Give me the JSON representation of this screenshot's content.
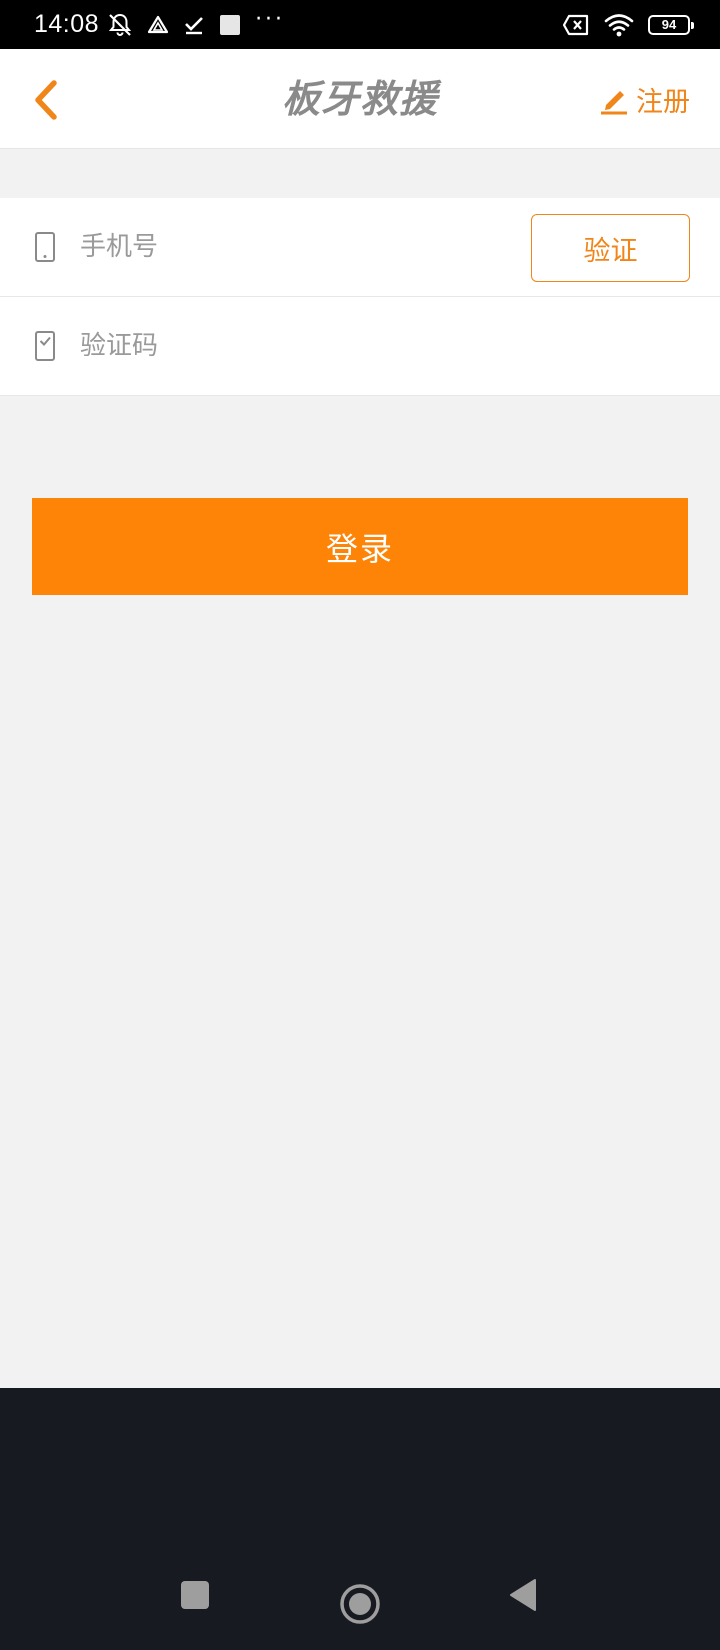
{
  "status_bar": {
    "time": "14:08",
    "left_icons": [
      "bell-off-icon",
      "triangle-app-icon",
      "checkmark-icon",
      "square-app-icon"
    ],
    "overflow": "···",
    "right_icons": [
      "sim-missing-icon",
      "wifi-icon"
    ],
    "battery_level": "94"
  },
  "header": {
    "title": "板牙救援",
    "register_label": "注册",
    "accent_color": "#f08519"
  },
  "form": {
    "phone_placeholder": "手机号",
    "phone_value": "",
    "code_placeholder": "验证码",
    "code_value": "",
    "verify_label": "验证"
  },
  "login_button": {
    "label": "登录",
    "color": "#fd8406"
  },
  "nav_bar": {
    "buttons": [
      "recents-square-icon",
      "home-circle-icon",
      "back-triangle-icon"
    ]
  }
}
